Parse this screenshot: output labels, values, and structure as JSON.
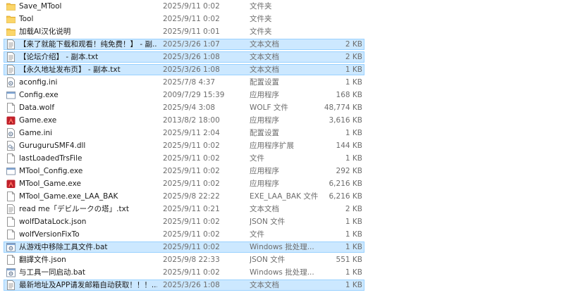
{
  "files": [
    {
      "name": "Save_MTool",
      "date": "2025/9/11 0:02",
      "type": "文件夹",
      "size": "",
      "icon": "folder-icon",
      "selected": false
    },
    {
      "name": "Tool",
      "date": "2025/9/11 0:02",
      "type": "文件夹",
      "size": "",
      "icon": "folder-icon",
      "selected": false
    },
    {
      "name": "加载AI汉化说明",
      "date": "2025/9/11 0:01",
      "type": "文件夹",
      "size": "",
      "icon": "folder-icon",
      "selected": false
    },
    {
      "name": "【来了就能下载和观看！纯免费！】 - 副...",
      "date": "2025/3/26 1:07",
      "type": "文本文档",
      "size": "2 KB",
      "icon": "text-file-icon",
      "selected": true
    },
    {
      "name": "【论坛介绍】 - 副本.txt",
      "date": "2025/3/26 1:08",
      "type": "文本文档",
      "size": "2 KB",
      "icon": "text-file-icon",
      "selected": true
    },
    {
      "name": "【永久地址发布页】 - 副本.txt",
      "date": "2025/3/26 1:08",
      "type": "文本文档",
      "size": "1 KB",
      "icon": "text-file-icon",
      "selected": true
    },
    {
      "name": "aconfig.ini",
      "date": "2025/7/8 4:37",
      "type": "配置设置",
      "size": "1 KB",
      "icon": "settings-file-icon",
      "selected": false
    },
    {
      "name": "Config.exe",
      "date": "2009/7/29 15:39",
      "type": "应用程序",
      "size": "168 KB",
      "icon": "window-app-icon",
      "selected": false
    },
    {
      "name": "Data.wolf",
      "date": "2025/9/4 3:08",
      "type": "WOLF 文件",
      "size": "48,774 KB",
      "icon": "blank-file-icon",
      "selected": false
    },
    {
      "name": "Game.exe",
      "date": "2013/8/2 18:00",
      "type": "应用程序",
      "size": "3,616 KB",
      "icon": "red-game-icon",
      "selected": false
    },
    {
      "name": "Game.ini",
      "date": "2025/9/11 2:04",
      "type": "配置设置",
      "size": "1 KB",
      "icon": "settings-file-icon",
      "selected": false
    },
    {
      "name": "GuruguruSMF4.dll",
      "date": "2025/9/11 0:02",
      "type": "应用程序扩展",
      "size": "144 KB",
      "icon": "dll-file-icon",
      "selected": false
    },
    {
      "name": "lastLoadedTrsFile",
      "date": "2025/9/11 0:02",
      "type": "文件",
      "size": "1 KB",
      "icon": "blank-file-icon",
      "selected": false
    },
    {
      "name": "MTool_Config.exe",
      "date": "2025/9/11 0:02",
      "type": "应用程序",
      "size": "292 KB",
      "icon": "window-app-icon",
      "selected": false
    },
    {
      "name": "MTool_Game.exe",
      "date": "2025/9/11 0:02",
      "type": "应用程序",
      "size": "6,216 KB",
      "icon": "red-game-icon",
      "selected": false
    },
    {
      "name": "MTool_Game.exe_LAA_BAK",
      "date": "2025/9/8 22:22",
      "type": "EXE_LAA_BAK 文件",
      "size": "6,216 KB",
      "icon": "blank-file-icon",
      "selected": false
    },
    {
      "name": "read me「デビルークの塔」.txt",
      "date": "2025/9/11 0:21",
      "type": "文本文档",
      "size": "2 KB",
      "icon": "text-file-icon",
      "selected": false
    },
    {
      "name": "wolfDataLock.json",
      "date": "2025/9/11 0:02",
      "type": "JSON 文件",
      "size": "1 KB",
      "icon": "blank-file-icon",
      "selected": false
    },
    {
      "name": "wolfVersionFixTo",
      "date": "2025/9/11 0:02",
      "type": "文件",
      "size": "1 KB",
      "icon": "blank-file-icon",
      "selected": false
    },
    {
      "name": "从游戏中移除工具文件.bat",
      "date": "2025/9/11 0:02",
      "type": "Windows 批处理...",
      "size": "1 KB",
      "icon": "batch-file-icon",
      "selected": true
    },
    {
      "name": "翻譯文件.json",
      "date": "2025/9/8 22:33",
      "type": "JSON 文件",
      "size": "551 KB",
      "icon": "blank-file-icon",
      "selected": false
    },
    {
      "name": "与工具一同启动.bat",
      "date": "2025/9/11 0:02",
      "type": "Windows 批处理...",
      "size": "1 KB",
      "icon": "batch-file-icon",
      "selected": false
    },
    {
      "name": "最新地址及APP请发邮箱自动获取！！！...",
      "date": "2025/3/26 1:08",
      "type": "文本文档",
      "size": "1 KB",
      "icon": "text-file-icon",
      "selected": true
    }
  ]
}
